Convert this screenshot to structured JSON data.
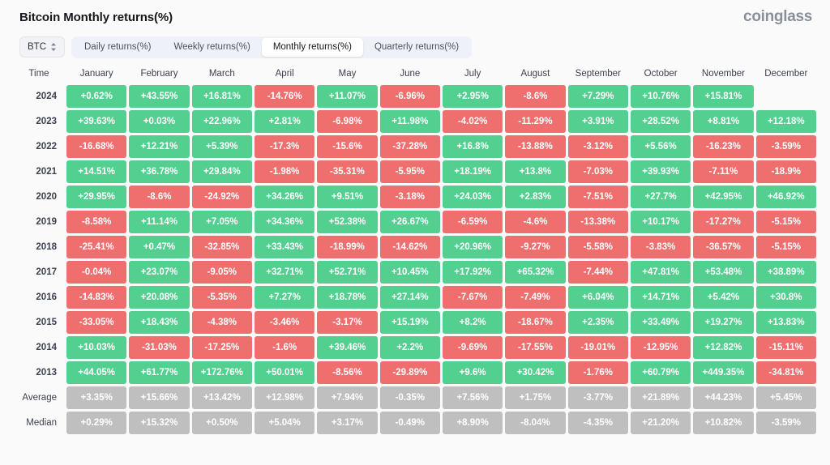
{
  "header": {
    "title": "Bitcoin Monthly returns(%)",
    "brand": "coinglass"
  },
  "controls": {
    "coin_selector": {
      "label": "BTC",
      "icon": "updown-chevron-icon"
    },
    "tabs": [
      {
        "label": "Daily returns(%)",
        "active": false
      },
      {
        "label": "Weekly returns(%)",
        "active": false
      },
      {
        "label": "Monthly returns(%)",
        "active": true
      },
      {
        "label": "Quarterly returns(%)",
        "active": false
      }
    ]
  },
  "colors": {
    "positive": "#53cf90",
    "negative": "#ef6f6f",
    "stat": "#bfbfbf",
    "background": "#fafafa",
    "brand_text": "#8a9099"
  },
  "chart_data": {
    "type": "heatmap",
    "title": "Bitcoin Monthly returns(%)",
    "xlabel": "",
    "ylabel": "Time",
    "legend": "green = positive return, red = negative return, grey = summary statistic",
    "time_header": "Time",
    "categories": [
      "January",
      "February",
      "March",
      "April",
      "May",
      "June",
      "July",
      "August",
      "September",
      "October",
      "November",
      "December"
    ],
    "rows": [
      {
        "label": "2024",
        "kind": "year",
        "values": [
          "+0.62%",
          "+43.55%",
          "+16.81%",
          "-14.76%",
          "+11.07%",
          "-6.96%",
          "+2.95%",
          "-8.6%",
          "+7.29%",
          "+10.76%",
          "+15.81%",
          ""
        ]
      },
      {
        "label": "2023",
        "kind": "year",
        "values": [
          "+39.63%",
          "+0.03%",
          "+22.96%",
          "+2.81%",
          "-6.98%",
          "+11.98%",
          "-4.02%",
          "-11.29%",
          "+3.91%",
          "+28.52%",
          "+8.81%",
          "+12.18%"
        ]
      },
      {
        "label": "2022",
        "kind": "year",
        "values": [
          "-16.68%",
          "+12.21%",
          "+5.39%",
          "-17.3%",
          "-15.6%",
          "-37.28%",
          "+16.8%",
          "-13.88%",
          "-3.12%",
          "+5.56%",
          "-16.23%",
          "-3.59%"
        ]
      },
      {
        "label": "2021",
        "kind": "year",
        "values": [
          "+14.51%",
          "+36.78%",
          "+29.84%",
          "-1.98%",
          "-35.31%",
          "-5.95%",
          "+18.19%",
          "+13.8%",
          "-7.03%",
          "+39.93%",
          "-7.11%",
          "-18.9%"
        ]
      },
      {
        "label": "2020",
        "kind": "year",
        "values": [
          "+29.95%",
          "-8.6%",
          "-24.92%",
          "+34.26%",
          "+9.51%",
          "-3.18%",
          "+24.03%",
          "+2.83%",
          "-7.51%",
          "+27.7%",
          "+42.95%",
          "+46.92%"
        ]
      },
      {
        "label": "2019",
        "kind": "year",
        "values": [
          "-8.58%",
          "+11.14%",
          "+7.05%",
          "+34.36%",
          "+52.38%",
          "+26.67%",
          "-6.59%",
          "-4.6%",
          "-13.38%",
          "+10.17%",
          "-17.27%",
          "-5.15%"
        ]
      },
      {
        "label": "2018",
        "kind": "year",
        "values": [
          "-25.41%",
          "+0.47%",
          "-32.85%",
          "+33.43%",
          "-18.99%",
          "-14.62%",
          "+20.96%",
          "-9.27%",
          "-5.58%",
          "-3.83%",
          "-36.57%",
          "-5.15%"
        ]
      },
      {
        "label": "2017",
        "kind": "year",
        "values": [
          "-0.04%",
          "+23.07%",
          "-9.05%",
          "+32.71%",
          "+52.71%",
          "+10.45%",
          "+17.92%",
          "+65.32%",
          "-7.44%",
          "+47.81%",
          "+53.48%",
          "+38.89%"
        ]
      },
      {
        "label": "2016",
        "kind": "year",
        "values": [
          "-14.83%",
          "+20.08%",
          "-5.35%",
          "+7.27%",
          "+18.78%",
          "+27.14%",
          "-7.67%",
          "-7.49%",
          "+6.04%",
          "+14.71%",
          "+5.42%",
          "+30.8%"
        ]
      },
      {
        "label": "2015",
        "kind": "year",
        "values": [
          "-33.05%",
          "+18.43%",
          "-4.38%",
          "-3.46%",
          "-3.17%",
          "+15.19%",
          "+8.2%",
          "-18.67%",
          "+2.35%",
          "+33.49%",
          "+19.27%",
          "+13.83%"
        ]
      },
      {
        "label": "2014",
        "kind": "year",
        "values": [
          "+10.03%",
          "-31.03%",
          "-17.25%",
          "-1.6%",
          "+39.46%",
          "+2.2%",
          "-9.69%",
          "-17.55%",
          "-19.01%",
          "-12.95%",
          "+12.82%",
          "-15.11%"
        ]
      },
      {
        "label": "2013",
        "kind": "year",
        "values": [
          "+44.05%",
          "+61.77%",
          "+172.76%",
          "+50.01%",
          "-8.56%",
          "-29.89%",
          "+9.6%",
          "+30.42%",
          "-1.76%",
          "+60.79%",
          "+449.35%",
          "-34.81%"
        ]
      },
      {
        "label": "Average",
        "kind": "stat",
        "values": [
          "+3.35%",
          "+15.66%",
          "+13.42%",
          "+12.98%",
          "+7.94%",
          "-0.35%",
          "+7.56%",
          "+1.75%",
          "-3.77%",
          "+21.89%",
          "+44.23%",
          "+5.45%"
        ]
      },
      {
        "label": "Median",
        "kind": "stat",
        "values": [
          "+0.29%",
          "+15.32%",
          "+0.50%",
          "+5.04%",
          "+3.17%",
          "-0.49%",
          "+8.90%",
          "-8.04%",
          "-4.35%",
          "+21.20%",
          "+10.82%",
          "-3.59%"
        ]
      }
    ]
  }
}
